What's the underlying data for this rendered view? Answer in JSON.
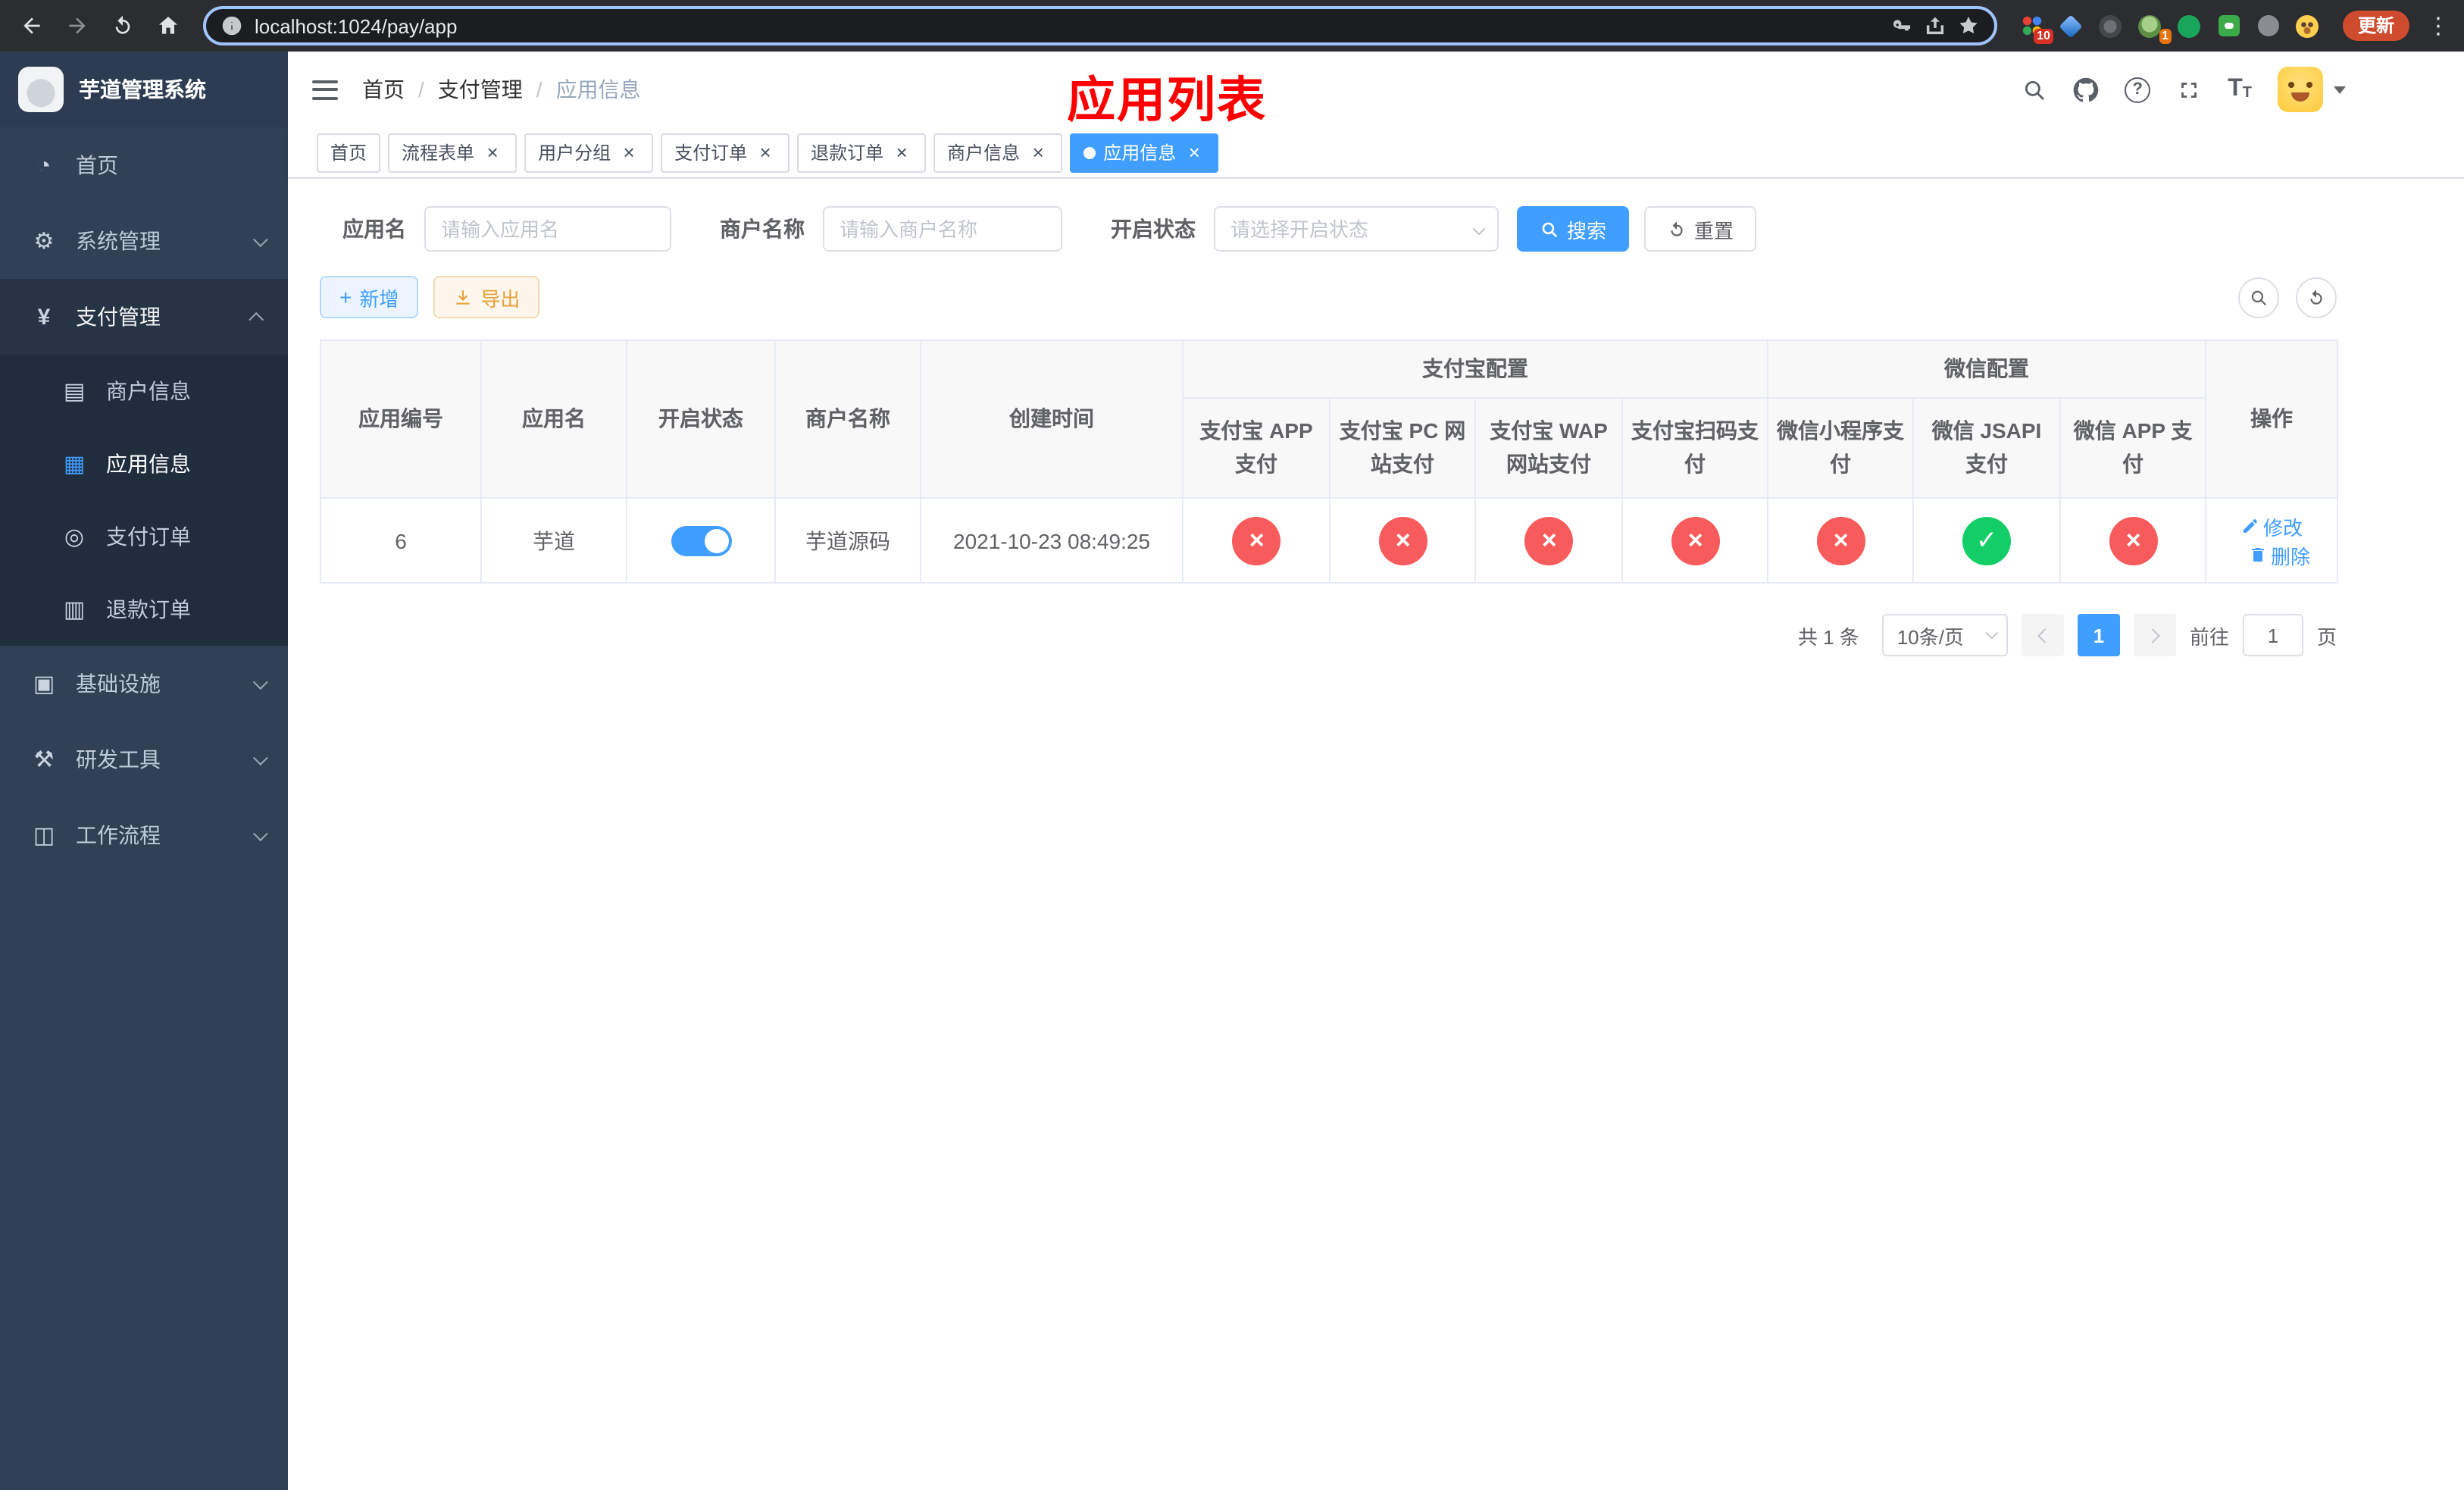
{
  "colors": {
    "accent": "#409eff",
    "danger": "#f75b5b",
    "success": "#13ce66",
    "warning": "#e6a23c",
    "sidebar_bg": "#304156",
    "submenu_bg": "#1f2d3d"
  },
  "glyphs": {
    "close": "×",
    "check": "✓",
    "cross": "×",
    "plus": "+",
    "kebab": "⋮",
    "help": "?",
    "slash": "/",
    "t_big": "T",
    "t_small": "T"
  },
  "icons": {
    "dashboard": "◔",
    "gear": "⚙",
    "yen": "¥",
    "merchant": "▤",
    "app": "▦",
    "order": "◎",
    "refund": "▥",
    "infra": "▣",
    "devtool": "⚒",
    "workflow": "◫"
  },
  "browser": {
    "url": "localhost:1024/pay/app",
    "update_label": "更新",
    "ext_badges": {
      "grid": "10",
      "avatar": "1"
    }
  },
  "sidebar": {
    "title": "芋道管理系统",
    "items": [
      {
        "label": "首页"
      },
      {
        "label": "系统管理"
      },
      {
        "label": "支付管理"
      },
      {
        "label": "基础设施"
      },
      {
        "label": "研发工具"
      },
      {
        "label": "工作流程"
      }
    ],
    "payment_children": [
      {
        "label": "商户信息"
      },
      {
        "label": "应用信息"
      },
      {
        "label": "支付订单"
      },
      {
        "label": "退款订单"
      }
    ]
  },
  "header": {
    "breadcrumb": [
      {
        "label": "首页"
      },
      {
        "label": "支付管理"
      },
      {
        "label": "应用信息"
      }
    ],
    "annotation": "应用列表"
  },
  "tabs": [
    {
      "label": "首页"
    },
    {
      "label": "流程表单"
    },
    {
      "label": "用户分组"
    },
    {
      "label": "支付订单"
    },
    {
      "label": "退款订单"
    },
    {
      "label": "商户信息"
    },
    {
      "label": "应用信息"
    }
  ],
  "filters": {
    "app_name_label": "应用名",
    "app_name_placeholder": "请输入应用名",
    "merchant_label": "商户名称",
    "merchant_placeholder": "请输入商户名称",
    "status_label": "开启状态",
    "status_placeholder": "请选择开启状态",
    "search_label": "搜索",
    "reset_label": "重置"
  },
  "toolbar": {
    "add_label": "新增",
    "export_label": "导出"
  },
  "table": {
    "columns": {
      "app_id": "应用编号",
      "app_name": "应用名",
      "status": "开启状态",
      "merchant": "商户名称",
      "created": "创建时间",
      "alipay_group": "支付宝配置",
      "wechat_group": "微信配置",
      "alipay_app": "支付宝 APP 支付",
      "alipay_pc": "支付宝 PC 网站支付",
      "alipay_wap": "支付宝 WAP 网站支付",
      "alipay_qr": "支付宝扫码支付",
      "wx_mini": "微信小程序支付",
      "wx_jsapi": "微信 JSAPI 支付",
      "wx_app": "微信 APP 支付",
      "actions": "操作"
    },
    "rows": [
      {
        "app_id": "6",
        "app_name": "芋道",
        "enabled": true,
        "merchant": "芋道源码",
        "created": "2021-10-23 08:49:25",
        "alipay_app": false,
        "alipay_pc": false,
        "alipay_wap": false,
        "alipay_qr": false,
        "wx_mini": false,
        "wx_jsapi": true,
        "wx_app": false,
        "edit_label": "修改",
        "delete_label": "删除"
      }
    ]
  },
  "pagination": {
    "total_text": "共 1 条",
    "page_size_text": "10条/页",
    "current_page": "1",
    "goto_prefix": "前往",
    "goto_value": "1",
    "goto_suffix": "页"
  }
}
